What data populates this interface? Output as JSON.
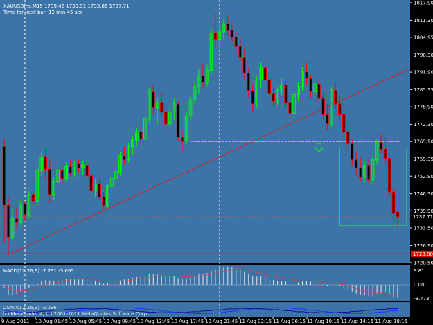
{
  "header": {
    "symbol_line": "XAUUSDins,M15  1739.46 1739.91 1733.86 1737.71",
    "timer_line": "Time for next bar: 12 min 45 sec"
  },
  "macd": {
    "label": "MACD(12,26,9) -7.731 -5.695",
    "scale": [
      "9.81",
      "0.00",
      "-8.773"
    ]
  },
  "footer": {
    "watermark": "(c) MetaTrader 4, (c) 2001-2011 MetaQuotes Software Corp.",
    "lower_label": "OSMA(12,26,9) -2.036"
  },
  "colors": {
    "background": "#3d74a8",
    "axis_bg": "#000000",
    "bull": "#00ff00",
    "bear": "#ff0000",
    "trend": "#d42020",
    "level_yellow": "#d8d800",
    "box_green": "#30e060",
    "dashed": "#ffffff",
    "support_red": "#ff0000",
    "price_tag": "#ff0000"
  },
  "chart_data": {
    "type": "candlestick",
    "symbol": "XAUUSDins",
    "timeframe": "M15",
    "last_price": "1737.71",
    "support_price": "1723.80",
    "y_ticks": [
      "1817.90",
      "1811.30",
      "1804.95",
      "1798.30",
      "1791.90",
      "1785.35",
      "1778.90",
      "1772.30",
      "1765.90",
      "1759.35",
      "1752.90",
      "1746.30",
      "1739.90",
      "1733.50",
      "1726.90",
      "1720.50"
    ],
    "y_range": [
      1720.5,
      1817.9
    ],
    "x_ticks": [
      "9 Aug 2011",
      "10 Aug 01:45",
      "10 Aug 05:45",
      "10 Aug 09:45",
      "10 Aug 13:45",
      "10 Aug 17:45",
      "10 Aug 21:45",
      "11 Aug 02:15",
      "11 Aug 06:15",
      "11 Aug 10:15",
      "11 Aug 14:15",
      "11 Aug 18:15"
    ],
    "horizontal_level": 1765.9,
    "candles": [
      {
        "o": 1764.0,
        "h": 1767.0,
        "l": 1728.0,
        "c": 1742.0
      },
      {
        "o": 1742.0,
        "h": 1745.0,
        "l": 1723.5,
        "c": 1730.0
      },
      {
        "o": 1730.0,
        "h": 1740.5,
        "l": 1729.0,
        "c": 1737.0
      },
      {
        "o": 1737.0,
        "h": 1741.0,
        "l": 1733.0,
        "c": 1735.5
      },
      {
        "o": 1735.5,
        "h": 1744.0,
        "l": 1734.0,
        "c": 1742.5
      },
      {
        "o": 1742.5,
        "h": 1743.5,
        "l": 1736.0,
        "c": 1738.5
      },
      {
        "o": 1738.5,
        "h": 1747.5,
        "l": 1737.0,
        "c": 1746.0
      },
      {
        "o": 1746.0,
        "h": 1749.5,
        "l": 1742.0,
        "c": 1743.5
      },
      {
        "o": 1743.5,
        "h": 1757.0,
        "l": 1742.0,
        "c": 1755.0
      },
      {
        "o": 1755.0,
        "h": 1762.0,
        "l": 1753.0,
        "c": 1760.0
      },
      {
        "o": 1760.0,
        "h": 1763.5,
        "l": 1752.0,
        "c": 1755.5
      },
      {
        "o": 1755.5,
        "h": 1759.5,
        "l": 1743.0,
        "c": 1746.0
      },
      {
        "o": 1746.0,
        "h": 1752.5,
        "l": 1744.0,
        "c": 1751.0
      },
      {
        "o": 1751.0,
        "h": 1757.0,
        "l": 1749.5,
        "c": 1755.0
      },
      {
        "o": 1755.0,
        "h": 1758.0,
        "l": 1750.0,
        "c": 1752.0
      },
      {
        "o": 1752.0,
        "h": 1758.0,
        "l": 1751.0,
        "c": 1756.5
      },
      {
        "o": 1756.5,
        "h": 1759.0,
        "l": 1753.0,
        "c": 1754.0
      },
      {
        "o": 1754.0,
        "h": 1758.5,
        "l": 1752.5,
        "c": 1757.5
      },
      {
        "o": 1757.5,
        "h": 1759.0,
        "l": 1754.5,
        "c": 1756.0
      },
      {
        "o": 1756.0,
        "h": 1758.5,
        "l": 1753.5,
        "c": 1757.0
      },
      {
        "o": 1757.0,
        "h": 1758.0,
        "l": 1752.0,
        "c": 1753.0
      },
      {
        "o": 1753.0,
        "h": 1754.0,
        "l": 1746.0,
        "c": 1747.5
      },
      {
        "o": 1747.5,
        "h": 1752.0,
        "l": 1745.0,
        "c": 1750.0
      },
      {
        "o": 1750.0,
        "h": 1751.5,
        "l": 1744.0,
        "c": 1745.0
      },
      {
        "o": 1745.0,
        "h": 1747.0,
        "l": 1740.5,
        "c": 1742.0
      },
      {
        "o": 1742.0,
        "h": 1750.0,
        "l": 1741.0,
        "c": 1749.0
      },
      {
        "o": 1749.0,
        "h": 1753.5,
        "l": 1747.0,
        "c": 1752.0
      },
      {
        "o": 1752.0,
        "h": 1756.0,
        "l": 1750.5,
        "c": 1754.5
      },
      {
        "o": 1754.5,
        "h": 1762.0,
        "l": 1753.0,
        "c": 1760.5
      },
      {
        "o": 1760.5,
        "h": 1764.0,
        "l": 1757.5,
        "c": 1759.0
      },
      {
        "o": 1759.0,
        "h": 1765.5,
        "l": 1758.0,
        "c": 1764.0
      },
      {
        "o": 1764.0,
        "h": 1768.0,
        "l": 1761.0,
        "c": 1766.5
      },
      {
        "o": 1766.5,
        "h": 1771.0,
        "l": 1764.0,
        "c": 1769.5
      },
      {
        "o": 1769.5,
        "h": 1773.0,
        "l": 1765.0,
        "c": 1767.0
      },
      {
        "o": 1767.0,
        "h": 1775.5,
        "l": 1766.0,
        "c": 1774.5
      },
      {
        "o": 1774.5,
        "h": 1786.0,
        "l": 1773.0,
        "c": 1784.5
      },
      {
        "o": 1784.5,
        "h": 1787.0,
        "l": 1776.0,
        "c": 1778.5
      },
      {
        "o": 1778.5,
        "h": 1782.5,
        "l": 1772.5,
        "c": 1780.5
      },
      {
        "o": 1780.5,
        "h": 1784.0,
        "l": 1775.5,
        "c": 1777.0
      },
      {
        "o": 1777.0,
        "h": 1779.0,
        "l": 1770.0,
        "c": 1772.5
      },
      {
        "o": 1772.5,
        "h": 1778.5,
        "l": 1771.0,
        "c": 1777.0
      },
      {
        "o": 1777.0,
        "h": 1782.0,
        "l": 1774.0,
        "c": 1780.0
      },
      {
        "o": 1780.0,
        "h": 1781.0,
        "l": 1766.0,
        "c": 1767.5
      },
      {
        "o": 1767.5,
        "h": 1770.0,
        "l": 1762.5,
        "c": 1766.0
      },
      {
        "o": 1766.0,
        "h": 1777.0,
        "l": 1765.0,
        "c": 1775.5
      },
      {
        "o": 1775.5,
        "h": 1783.0,
        "l": 1774.0,
        "c": 1781.5
      },
      {
        "o": 1781.5,
        "h": 1788.5,
        "l": 1779.5,
        "c": 1786.5
      },
      {
        "o": 1786.5,
        "h": 1793.0,
        "l": 1784.0,
        "c": 1790.5
      },
      {
        "o": 1790.5,
        "h": 1795.0,
        "l": 1786.0,
        "c": 1788.0
      },
      {
        "o": 1788.0,
        "h": 1794.5,
        "l": 1786.5,
        "c": 1792.5
      },
      {
        "o": 1792.5,
        "h": 1808.5,
        "l": 1791.0,
        "c": 1806.5
      },
      {
        "o": 1806.5,
        "h": 1814.0,
        "l": 1801.0,
        "c": 1804.0
      },
      {
        "o": 1804.0,
        "h": 1809.5,
        "l": 1800.5,
        "c": 1807.0
      },
      {
        "o": 1807.0,
        "h": 1812.0,
        "l": 1804.0,
        "c": 1810.0
      },
      {
        "o": 1810.0,
        "h": 1813.5,
        "l": 1805.5,
        "c": 1807.5
      },
      {
        "o": 1807.5,
        "h": 1810.5,
        "l": 1803.5,
        "c": 1805.0
      },
      {
        "o": 1805.0,
        "h": 1807.0,
        "l": 1799.5,
        "c": 1801.5
      },
      {
        "o": 1801.5,
        "h": 1805.0,
        "l": 1796.0,
        "c": 1797.5
      },
      {
        "o": 1797.5,
        "h": 1800.5,
        "l": 1789.0,
        "c": 1791.5
      },
      {
        "o": 1791.5,
        "h": 1794.0,
        "l": 1782.5,
        "c": 1785.0
      },
      {
        "o": 1785.0,
        "h": 1787.5,
        "l": 1777.0,
        "c": 1780.0
      },
      {
        "o": 1780.0,
        "h": 1790.5,
        "l": 1778.5,
        "c": 1789.0
      },
      {
        "o": 1789.0,
        "h": 1795.5,
        "l": 1786.0,
        "c": 1793.5
      },
      {
        "o": 1793.5,
        "h": 1797.0,
        "l": 1787.0,
        "c": 1789.0
      },
      {
        "o": 1789.0,
        "h": 1792.0,
        "l": 1781.0,
        "c": 1784.0
      },
      {
        "o": 1784.0,
        "h": 1786.0,
        "l": 1779.0,
        "c": 1781.0
      },
      {
        "o": 1781.0,
        "h": 1786.5,
        "l": 1779.5,
        "c": 1785.0
      },
      {
        "o": 1785.0,
        "h": 1789.5,
        "l": 1783.0,
        "c": 1787.0
      },
      {
        "o": 1787.0,
        "h": 1788.5,
        "l": 1778.5,
        "c": 1780.5
      },
      {
        "o": 1780.5,
        "h": 1783.0,
        "l": 1774.5,
        "c": 1776.5
      },
      {
        "o": 1776.5,
        "h": 1785.0,
        "l": 1775.0,
        "c": 1783.5
      },
      {
        "o": 1783.5,
        "h": 1788.0,
        "l": 1781.0,
        "c": 1786.5
      },
      {
        "o": 1786.5,
        "h": 1794.0,
        "l": 1785.0,
        "c": 1792.0
      },
      {
        "o": 1792.0,
        "h": 1795.5,
        "l": 1787.0,
        "c": 1789.5
      },
      {
        "o": 1789.5,
        "h": 1791.0,
        "l": 1782.0,
        "c": 1784.5
      },
      {
        "o": 1784.5,
        "h": 1789.0,
        "l": 1782.5,
        "c": 1787.5
      },
      {
        "o": 1787.5,
        "h": 1789.5,
        "l": 1780.0,
        "c": 1782.0
      },
      {
        "o": 1782.0,
        "h": 1784.0,
        "l": 1774.0,
        "c": 1776.0
      },
      {
        "o": 1776.0,
        "h": 1780.0,
        "l": 1770.5,
        "c": 1772.5
      },
      {
        "o": 1772.5,
        "h": 1786.5,
        "l": 1771.5,
        "c": 1785.0
      },
      {
        "o": 1785.0,
        "h": 1788.0,
        "l": 1778.0,
        "c": 1780.0
      },
      {
        "o": 1780.0,
        "h": 1783.0,
        "l": 1773.5,
        "c": 1776.0
      },
      {
        "o": 1776.0,
        "h": 1779.0,
        "l": 1767.0,
        "c": 1769.5
      },
      {
        "o": 1769.5,
        "h": 1772.0,
        "l": 1762.5,
        "c": 1765.0
      },
      {
        "o": 1765.0,
        "h": 1767.0,
        "l": 1757.0,
        "c": 1759.0
      },
      {
        "o": 1759.0,
        "h": 1762.0,
        "l": 1753.5,
        "c": 1756.0
      },
      {
        "o": 1756.0,
        "h": 1760.0,
        "l": 1751.0,
        "c": 1752.5
      },
      {
        "o": 1752.5,
        "h": 1758.5,
        "l": 1750.5,
        "c": 1757.0
      },
      {
        "o": 1757.0,
        "h": 1759.0,
        "l": 1750.0,
        "c": 1751.5
      },
      {
        "o": 1751.5,
        "h": 1760.5,
        "l": 1750.0,
        "c": 1759.0
      },
      {
        "o": 1759.0,
        "h": 1767.0,
        "l": 1757.5,
        "c": 1765.5
      },
      {
        "o": 1765.5,
        "h": 1768.5,
        "l": 1761.5,
        "c": 1763.0
      },
      {
        "o": 1763.0,
        "h": 1767.5,
        "l": 1757.0,
        "c": 1759.5
      },
      {
        "o": 1759.5,
        "h": 1761.0,
        "l": 1745.5,
        "c": 1747.0
      },
      {
        "o": 1747.0,
        "h": 1748.5,
        "l": 1736.5,
        "c": 1739.0
      },
      {
        "o": 1739.46,
        "h": 1739.91,
        "l": 1733.86,
        "c": 1737.71
      }
    ],
    "macd_hist": [
      -2.0,
      -5.5,
      -6.0,
      -5.0,
      -3.5,
      -2.5,
      -1.5,
      -0.5,
      1.0,
      2.0,
      2.5,
      2.2,
      2.0,
      2.5,
      2.8,
      3.0,
      3.0,
      3.2,
      3.0,
      3.1,
      2.8,
      2.2,
      1.8,
      1.2,
      0.5,
      0.8,
      1.2,
      1.6,
      2.3,
      2.8,
      3.2,
      3.6,
      4.0,
      4.1,
      4.5,
      5.4,
      5.6,
      5.5,
      5.2,
      4.6,
      4.4,
      4.5,
      3.6,
      3.0,
      3.2,
      3.8,
      4.6,
      5.4,
      5.8,
      6.1,
      7.4,
      8.2,
      8.8,
      9.3,
      9.5,
      9.3,
      8.8,
      8.0,
      7.0,
      5.8,
      4.5,
      4.2,
      4.3,
      4.0,
      3.4,
      2.6,
      2.2,
      2.1,
      1.6,
      0.8,
      0.9,
      1.2,
      1.9,
      2.0,
      1.6,
      1.6,
      1.1,
      0.2,
      -0.7,
      0.0,
      0.0,
      -0.5,
      -1.5,
      -2.6,
      -3.8,
      -5.0,
      -5.9,
      -6.1,
      -6.6,
      -6.2,
      -5.2,
      -4.6,
      -4.5,
      -5.8,
      -7.2,
      -7.73
    ],
    "macd_signal": [
      -1.0,
      -2.0,
      -3.0,
      -3.6,
      -3.8,
      -3.5,
      -3.0,
      -2.3,
      -1.5,
      -0.6,
      0.2,
      0.8,
      1.2,
      1.6,
      2.0,
      2.3,
      2.5,
      2.7,
      2.8,
      2.9,
      2.9,
      2.8,
      2.6,
      2.3,
      2.0,
      1.8,
      1.7,
      1.7,
      1.8,
      2.0,
      2.3,
      2.6,
      2.9,
      3.2,
      3.5,
      3.9,
      4.3,
      4.6,
      4.8,
      4.8,
      4.8,
      4.8,
      4.6,
      4.3,
      4.1,
      4.1,
      4.2,
      4.5,
      4.8,
      5.1,
      5.6,
      6.1,
      6.7,
      7.2,
      7.7,
      8.0,
      8.2,
      8.2,
      8.0,
      7.6,
      7.0,
      6.4,
      5.9,
      5.5,
      5.0,
      4.6,
      4.1,
      3.7,
      3.3,
      2.9,
      2.5,
      2.2,
      2.1,
      2.0,
      1.9,
      1.8,
      1.7,
      1.4,
      1.0,
      0.8,
      0.6,
      0.4,
      0.0,
      -0.6,
      -1.3,
      -2.1,
      -2.9,
      -3.6,
      -4.2,
      -4.6,
      -4.8,
      -4.9,
      -5.0,
      -5.2,
      -5.5,
      -5.695
    ]
  }
}
